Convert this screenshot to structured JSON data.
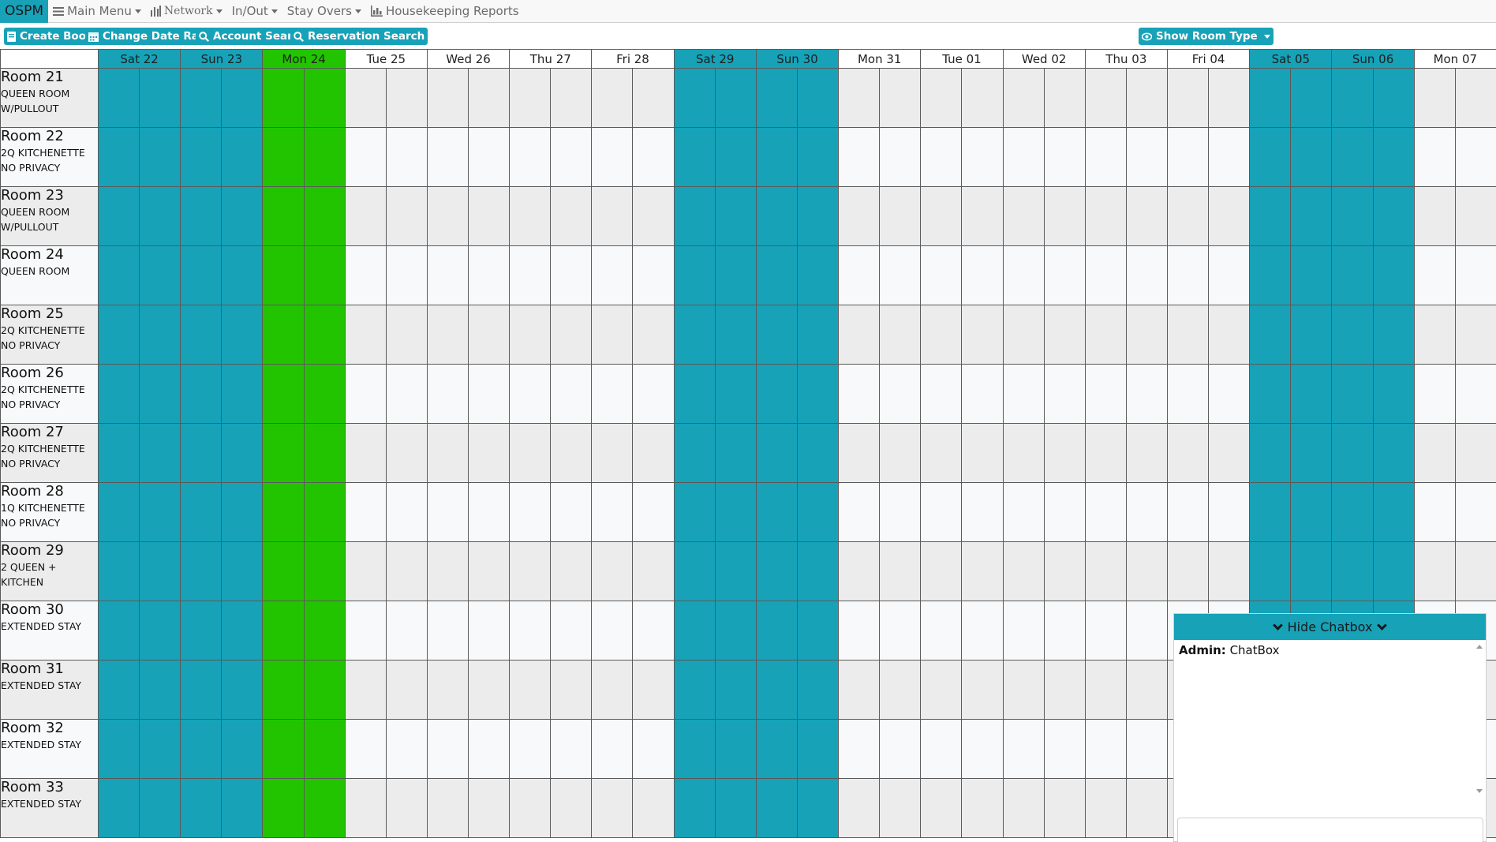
{
  "navbar": {
    "brand": "OSPM",
    "items": [
      {
        "label": "Main Menu",
        "icon": "hamburger-icon",
        "dropdown": true
      },
      {
        "label": "Network",
        "icon": "bar-chart-icon",
        "dropdown": true
      },
      {
        "label": "In/Out",
        "icon": "",
        "dropdown": true
      },
      {
        "label": "Stay Overs",
        "icon": "",
        "dropdown": true
      },
      {
        "label": "Housekeeping Reports",
        "icon": "report-chart-icon",
        "dropdown": false
      }
    ]
  },
  "toolbar": {
    "create_booking": "Create Booking",
    "change_date_range": "Change Date Range",
    "account_search": "Account Search",
    "reservation_search": "Reservation Search",
    "show_room_type": "Show Room Type"
  },
  "colors": {
    "accent": "#17a2b8",
    "today": "#22c400",
    "row_alt": "#ececec",
    "row_norm": "#f8f9fa"
  },
  "calendar": {
    "days": [
      {
        "label": "Sat 22",
        "kind": "weekend"
      },
      {
        "label": "Sun 23",
        "kind": "weekend"
      },
      {
        "label": "Mon 24",
        "kind": "today"
      },
      {
        "label": "Tue 25",
        "kind": "normal"
      },
      {
        "label": "Wed 26",
        "kind": "normal"
      },
      {
        "label": "Thu 27",
        "kind": "normal"
      },
      {
        "label": "Fri 28",
        "kind": "normal"
      },
      {
        "label": "Sat 29",
        "kind": "weekend"
      },
      {
        "label": "Sun 30",
        "kind": "weekend"
      },
      {
        "label": "Mon 31",
        "kind": "normal"
      },
      {
        "label": "Tue 01",
        "kind": "normal"
      },
      {
        "label": "Wed 02",
        "kind": "normal"
      },
      {
        "label": "Thu 03",
        "kind": "normal"
      },
      {
        "label": "Fri 04",
        "kind": "normal"
      },
      {
        "label": "Sat 05",
        "kind": "weekend"
      },
      {
        "label": "Sun 06",
        "kind": "weekend"
      },
      {
        "label": "Mon 07",
        "kind": "normal"
      }
    ],
    "rooms": [
      {
        "name": "Room 21",
        "type": [
          "QUEEN ROOM",
          "W/PULLOUT"
        ]
      },
      {
        "name": "Room 22",
        "type": [
          "2Q KITCHENETTE",
          "NO PRIVACY"
        ]
      },
      {
        "name": "Room 23",
        "type": [
          "QUEEN ROOM",
          "W/PULLOUT"
        ]
      },
      {
        "name": "Room 24",
        "type": [
          "QUEEN ROOM"
        ]
      },
      {
        "name": "Room 25",
        "type": [
          "2Q KITCHENETTE",
          "NO PRIVACY"
        ]
      },
      {
        "name": "Room 26",
        "type": [
          "2Q KITCHENETTE",
          "NO PRIVACY"
        ]
      },
      {
        "name": "Room 27",
        "type": [
          "2Q KITCHENETTE",
          "NO PRIVACY"
        ]
      },
      {
        "name": "Room 28",
        "type": [
          "1Q KITCHENETTE",
          "NO PRIVACY"
        ]
      },
      {
        "name": "Room 29",
        "type": [
          "2 QUEEN +",
          "KITCHEN"
        ]
      },
      {
        "name": "Room 30",
        "type": [
          "EXTENDED STAY"
        ]
      },
      {
        "name": "Room 31",
        "type": [
          "EXTENDED STAY"
        ]
      },
      {
        "name": "Room 32",
        "type": [
          "EXTENDED STAY"
        ]
      },
      {
        "name": "Room 33",
        "type": [
          "EXTENDED STAY"
        ]
      }
    ]
  },
  "chatbox": {
    "toggle_label": "Hide Chatbox",
    "messages": [
      {
        "author": "Admin:",
        "text": "ChatBox"
      }
    ],
    "input_value": ""
  }
}
